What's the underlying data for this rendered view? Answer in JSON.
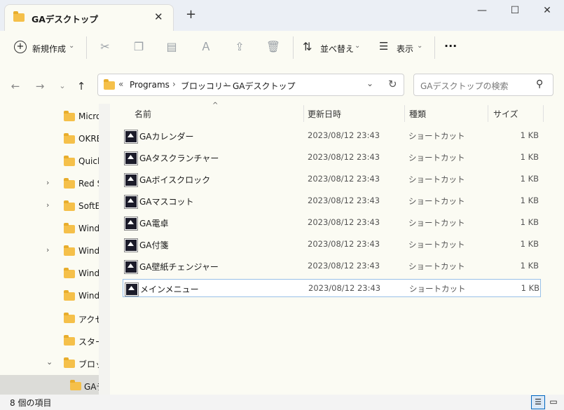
{
  "tab": {
    "title": "GAデスクトップ",
    "close": "✕",
    "new_tab": "+"
  },
  "window": {
    "minimize": "—",
    "maximize": "☐",
    "close": "✕"
  },
  "toolbar": {
    "new_label": "新規作成",
    "sort_label": "並べ替え",
    "view_label": "表示",
    "more": "···"
  },
  "address": {
    "chevron": "«",
    "crumbs": [
      "Programs",
      "ブロッコリー",
      "GAデスクトップ"
    ],
    "sep": "›"
  },
  "search": {
    "placeholder": "GAデスクトップの検索"
  },
  "sidebar": {
    "items": [
      {
        "label": "Micro",
        "expandable": false
      },
      {
        "label": "OKRE",
        "expandable": false
      },
      {
        "label": "Quick",
        "expandable": false
      },
      {
        "label": "Red S",
        "expandable": true,
        "chev": "›"
      },
      {
        "label": "SoftE",
        "expandable": true,
        "chev": "›"
      },
      {
        "label": "Wind",
        "expandable": false
      },
      {
        "label": "Wind",
        "expandable": true,
        "chev": "›"
      },
      {
        "label": "Wind",
        "expandable": false
      },
      {
        "label": "Wind",
        "expandable": false
      },
      {
        "label": "アクセ",
        "expandable": false
      },
      {
        "label": "スター",
        "expandable": false
      },
      {
        "label": "ブロッ",
        "expandable": true,
        "chev": "⌄"
      },
      {
        "label": "GAデ",
        "expandable": false
      }
    ]
  },
  "columns": {
    "name": "名前",
    "date": "更新日時",
    "type": "種類",
    "size": "サイズ"
  },
  "files": [
    {
      "name": "GAカレンダー",
      "date": "2023/08/12 23:43",
      "type": "ショートカット",
      "size": "1 KB"
    },
    {
      "name": "GAタスクランチャー",
      "date": "2023/08/12 23:43",
      "type": "ショートカット",
      "size": "1 KB"
    },
    {
      "name": "GAボイスクロック",
      "date": "2023/08/12 23:43",
      "type": "ショートカット",
      "size": "1 KB"
    },
    {
      "name": "GAマスコット",
      "date": "2023/08/12 23:43",
      "type": "ショートカット",
      "size": "1 KB"
    },
    {
      "name": "GA電卓",
      "date": "2023/08/12 23:43",
      "type": "ショートカット",
      "size": "1 KB"
    },
    {
      "name": "GA付箋",
      "date": "2023/08/12 23:43",
      "type": "ショートカット",
      "size": "1 KB"
    },
    {
      "name": "GA壁紙チェンジャー",
      "date": "2023/08/12 23:43",
      "type": "ショートカット",
      "size": "1 KB"
    },
    {
      "name": "メインメニュー",
      "date": "2023/08/12 23:43",
      "type": "ショートカット",
      "size": "1 KB"
    }
  ],
  "status": {
    "count": "8 個の項目"
  },
  "colors": {
    "accent": "#0067c0",
    "folder": "#f5c04a",
    "selection_border": "#99c0e8"
  }
}
